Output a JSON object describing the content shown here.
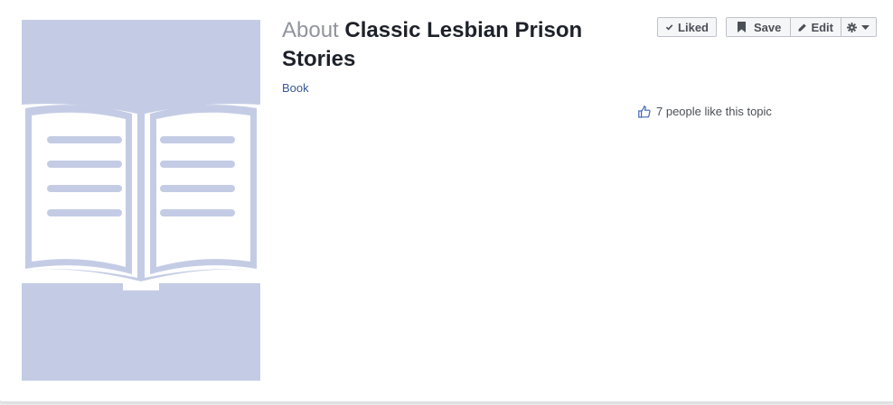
{
  "page": {
    "title_prefix": "About",
    "title": "Classic Lesbian Prison Stories",
    "category": "Book"
  },
  "actions": {
    "liked_label": "Liked",
    "save_label": "Save",
    "edit_label": "Edit"
  },
  "likes": {
    "text": "7 people like this topic"
  },
  "icons": {
    "liked": "checkmark-icon",
    "save": "bookmark-icon",
    "edit": "pencil-icon",
    "settings": "gear-icon",
    "dropdown": "caret-down-icon",
    "likes": "thumbs-up-icon",
    "cover": "open-book-icon"
  },
  "colors": {
    "cover_background": "#c4cce5",
    "link": "#385898",
    "title": "#1d2129",
    "prefix": "#90949c",
    "button_bg": "#f5f6f7",
    "button_border": "#bec3c9"
  }
}
